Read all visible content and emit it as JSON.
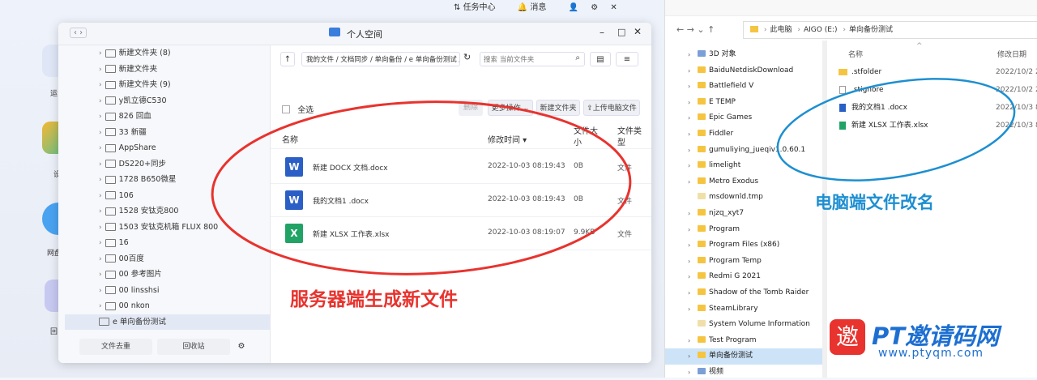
{
  "desktop": {
    "topbar": {
      "task_center": "任务中心",
      "messages": "消息"
    },
    "dock_labels": [
      "运",
      "设",
      "网盘",
      "回"
    ]
  },
  "nas": {
    "title": "个人空间",
    "path": "我的文件 / 文档同步 / 单向备份 / e 单向备份测试 /",
    "search_placeholder": "搜索 当前文件夹",
    "select_all": "全选",
    "toolbar": {
      "delete": "删除",
      "more": "更多操作",
      "new_folder": "新建文件夹",
      "upload": "上传电脑文件"
    },
    "columns": {
      "name": "名称",
      "modified": "修改时间",
      "size": "文件大小",
      "type": "文件类型"
    },
    "files": [
      {
        "icon": "W",
        "name": "新建 DOCX 文档.docx",
        "time": "2022-10-03 08:19:43",
        "size": "0B",
        "type": "文件",
        "color": "#2b5fc6"
      },
      {
        "icon": "W",
        "name": "我的文档1 .docx",
        "time": "2022-10-03 08:19:43",
        "size": "0B",
        "type": "文件",
        "color": "#2b5fc6"
      },
      {
        "icon": "X",
        "name": "新建 XLSX 工作表.xlsx",
        "time": "2022-10-03 08:19:07",
        "size": "9.9KB",
        "type": "文件",
        "color": "#21a366"
      }
    ],
    "tree": [
      "新建文件夹 (8)",
      "新建文件夹",
      "新建文件夹 (9)",
      "y凯立德C530",
      "826 回血",
      "33 新疆",
      "AppShare",
      "DS220+同步",
      "1728 B650微星",
      "106",
      "1528 安钛克800",
      "1503 安钛克机箱 FLUX 800",
      "16",
      "00百度",
      "00 参考图片",
      "00 linsshsi",
      "00 nkon"
    ],
    "tree_selected": "e 单向备份测试",
    "bottom": {
      "trash_label": "文件去重",
      "recycle_label": "回收站"
    }
  },
  "explorer": {
    "breadcrumb": [
      "此电脑",
      "AIGO (E:)",
      "单向备份测试"
    ],
    "columns": {
      "name": "名称",
      "modified": "修改日期"
    },
    "nav": [
      {
        "label": "3D 对象",
        "kind": "special"
      },
      {
        "label": "BaiduNetdiskDownload",
        "kind": "folder"
      },
      {
        "label": "Battlefield V",
        "kind": "folder"
      },
      {
        "label": "E TEMP",
        "kind": "folder"
      },
      {
        "label": "Epic Games",
        "kind": "folder"
      },
      {
        "label": "Fiddler",
        "kind": "folder"
      },
      {
        "label": "gumuliying_jueqiv1.0.60.1",
        "kind": "folder"
      },
      {
        "label": "limelight",
        "kind": "folder"
      },
      {
        "label": "Metro Exodus",
        "kind": "folder"
      },
      {
        "label": "msdownld.tmp",
        "kind": "plain"
      },
      {
        "label": "njzq_xyt7",
        "kind": "folder"
      },
      {
        "label": "Program",
        "kind": "folder"
      },
      {
        "label": "Program Files (x86)",
        "kind": "folder"
      },
      {
        "label": "Program Temp",
        "kind": "folder"
      },
      {
        "label": "Redmi G 2021",
        "kind": "folder"
      },
      {
        "label": "Shadow of the Tomb Raider",
        "kind": "folder"
      },
      {
        "label": "SteamLibrary",
        "kind": "folder"
      },
      {
        "label": "System Volume Information",
        "kind": "plain"
      },
      {
        "label": "Test Program",
        "kind": "folder"
      },
      {
        "label": "单向备份测试",
        "kind": "folder",
        "selected": true
      },
      {
        "label": "视频",
        "kind": "special"
      }
    ],
    "files": [
      {
        "name": ".stfolder",
        "date": "2022/10/2 2",
        "kind": "folder"
      },
      {
        "name": ".stignore",
        "date": "2022/10/2 2",
        "kind": "file"
      },
      {
        "name": "我的文档1 .docx",
        "date": "2022/10/3 8",
        "kind": "doc"
      },
      {
        "name": "新建 XLSX 工作表.xlsx",
        "date": "2022/10/3 8",
        "kind": "xls"
      }
    ]
  },
  "annotations": {
    "server": "服务器端生成新文件",
    "pc": "电脑端文件改名",
    "watermark_title": "PT邀请码网",
    "watermark_url": "www.ptyqm.com"
  },
  "colors": {
    "red_annotation": "#e8332e",
    "blue_annotation": "#1d8fd1",
    "accent": "#3b7ddd"
  }
}
